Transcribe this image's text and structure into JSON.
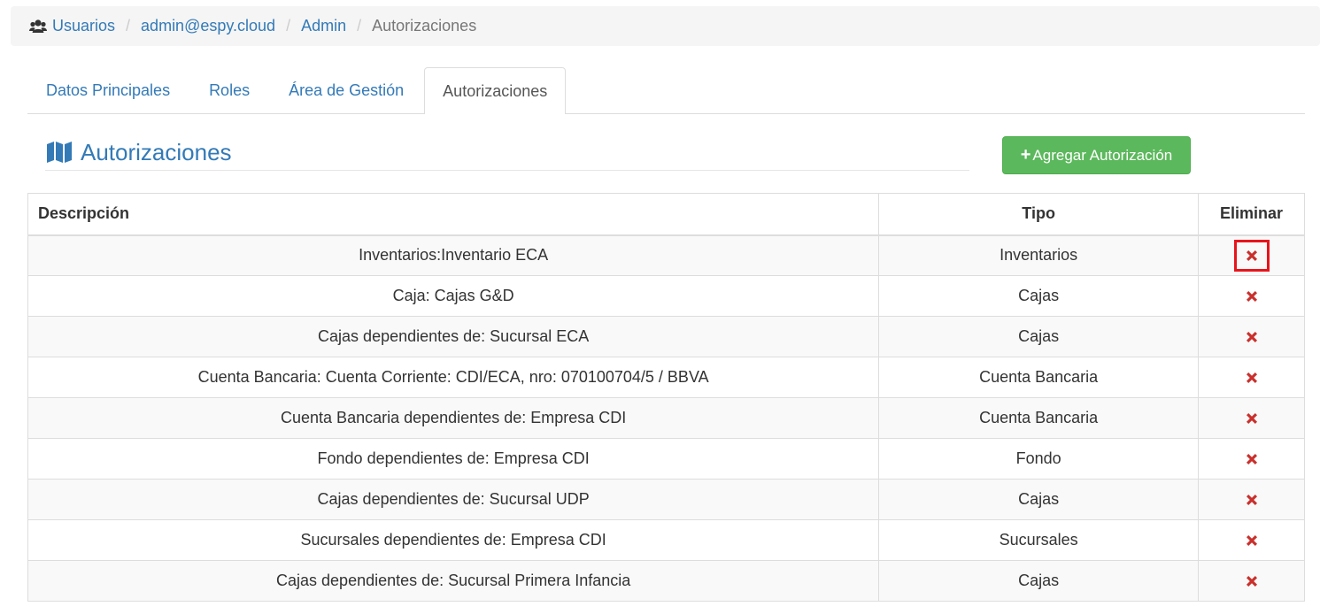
{
  "breadcrumb": {
    "items": [
      {
        "label": "Usuarios",
        "icon": "users-icon"
      },
      {
        "label": "admin@espy.cloud"
      },
      {
        "label": "Admin"
      },
      {
        "label": "Autorizaciones"
      }
    ],
    "separator": "/"
  },
  "tabs": [
    {
      "label": "Datos Principales",
      "active": false
    },
    {
      "label": "Roles",
      "active": false
    },
    {
      "label": "Área de Gestión",
      "active": false
    },
    {
      "label": "Autorizaciones",
      "active": true
    }
  ],
  "section": {
    "title": "Autorizaciones",
    "icon": "map-icon"
  },
  "add_button": {
    "plus": "+",
    "label": "Agregar Autorización"
  },
  "table": {
    "headers": {
      "description": "Descripción",
      "type": "Tipo",
      "delete": "Eliminar"
    },
    "rows": [
      {
        "description": "Inventarios:Inventario ECA",
        "type": "Inventarios",
        "highlighted": true
      },
      {
        "description": "Caja: Cajas G&D",
        "type": "Cajas"
      },
      {
        "description": "Cajas dependientes de: Sucursal ECA",
        "type": "Cajas"
      },
      {
        "description": "Cuenta Bancaria: Cuenta Corriente: CDI/ECA, nro: 070100704/5 / BBVA",
        "type": "Cuenta Bancaria"
      },
      {
        "description": "Cuenta Bancaria dependientes de: Empresa CDI",
        "type": "Cuenta Bancaria"
      },
      {
        "description": "Fondo dependientes de: Empresa CDI",
        "type": "Fondo"
      },
      {
        "description": "Cajas dependientes de: Sucursal UDP",
        "type": "Cajas"
      },
      {
        "description": "Sucursales dependientes de: Empresa CDI",
        "type": "Sucursales"
      },
      {
        "description": "Cajas dependientes de: Sucursal Primera Infancia",
        "type": "Cajas"
      }
    ]
  },
  "colors": {
    "link": "#337ab7",
    "success": "#5cb85c",
    "delete_icon": "#c9302c",
    "highlight": "#e8141b"
  }
}
